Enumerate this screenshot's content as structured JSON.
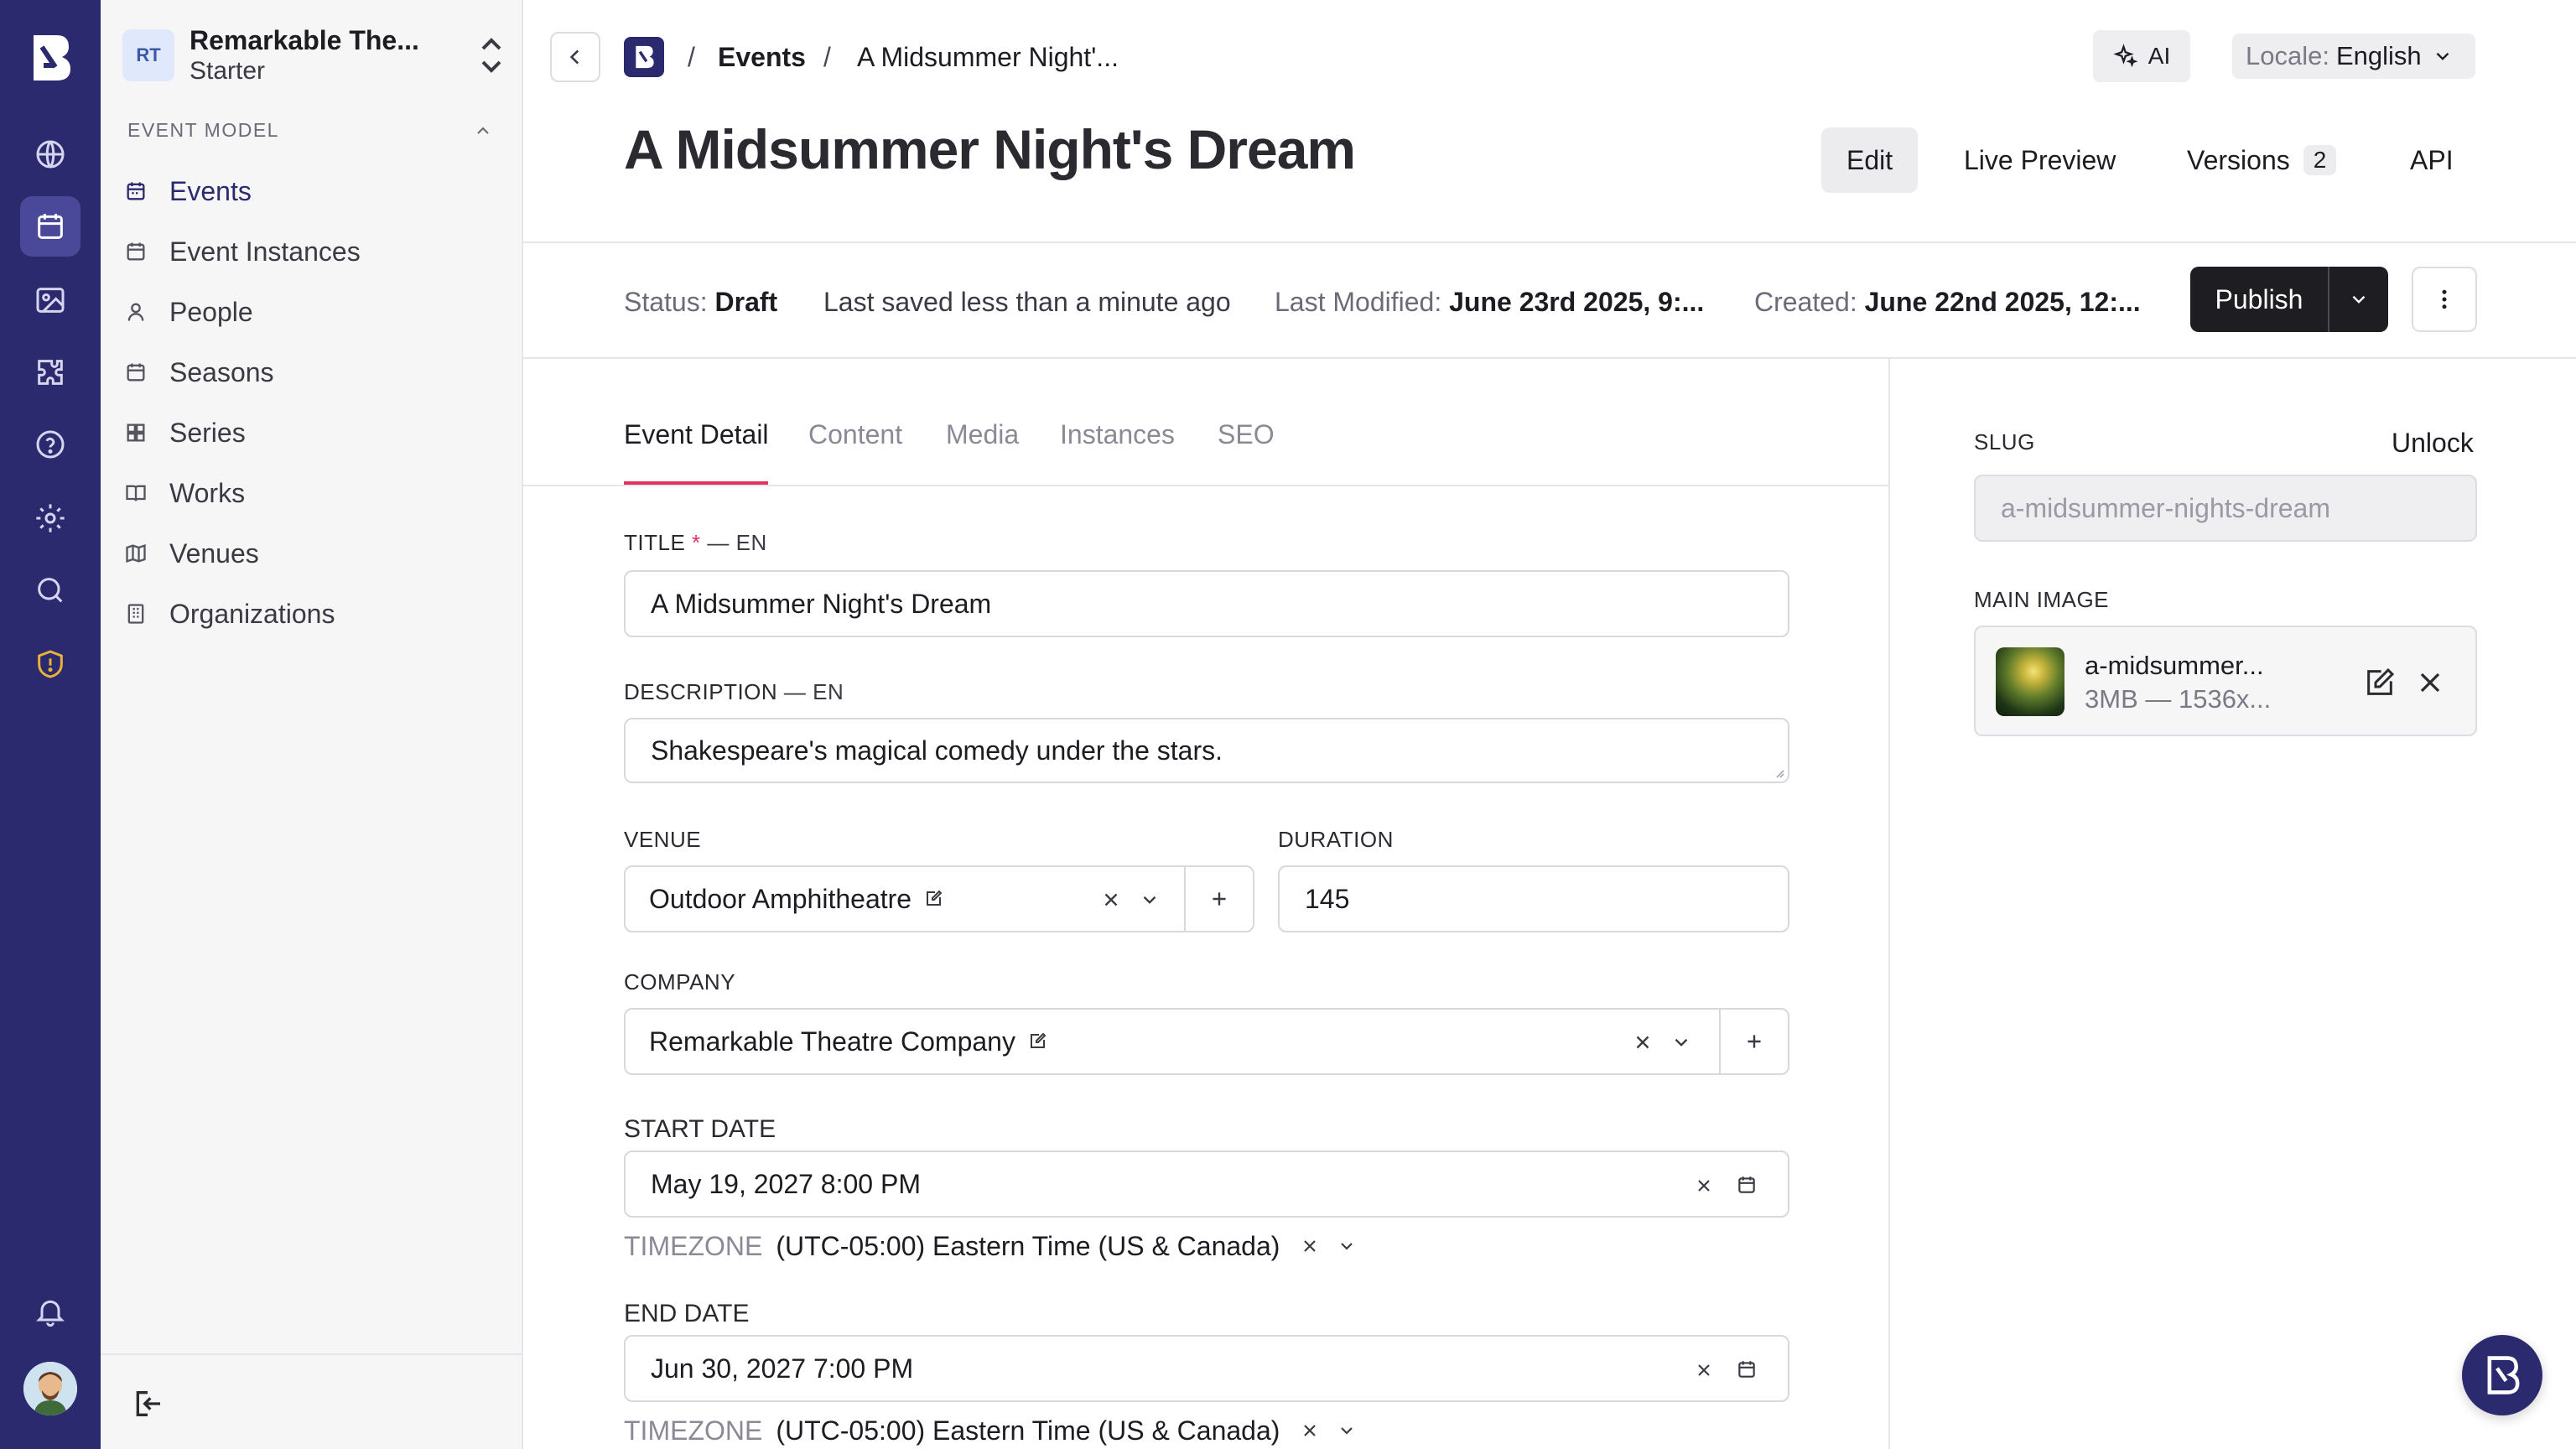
{
  "org": {
    "initials": "RT",
    "name": "Remarkable The...",
    "plan": "Starter"
  },
  "sidebar": {
    "section_label": "EVENT MODEL",
    "items": [
      {
        "label": "Events",
        "icon": "calendar-icon",
        "active": true
      },
      {
        "label": "Event Instances",
        "icon": "calendar-icon"
      },
      {
        "label": "People",
        "icon": "person-icon"
      },
      {
        "label": "Seasons",
        "icon": "calendar-icon"
      },
      {
        "label": "Series",
        "icon": "grid-icon"
      },
      {
        "label": "Works",
        "icon": "book-icon"
      },
      {
        "label": "Venues",
        "icon": "map-icon"
      },
      {
        "label": "Organizations",
        "icon": "building-icon"
      }
    ]
  },
  "rail": {
    "icons": [
      "globe-icon",
      "calendar-icon",
      "image-icon",
      "puzzle-icon",
      "help-icon",
      "settings-icon",
      "search-icon",
      "shield-alert-icon",
      "bell-icon"
    ],
    "active": "calendar-icon",
    "accent": "#2c2a6e"
  },
  "breadcrumb": {
    "sep": "/",
    "section": "Events",
    "page": "A Midsummer Night'..."
  },
  "header": {
    "ai_label": "AI",
    "locale_label": "Locale:",
    "locale_value": "English",
    "title": "A Midsummer Night's Dream",
    "tabs": [
      {
        "label": "Edit",
        "active": true
      },
      {
        "label": "Live Preview"
      },
      {
        "label": "Versions",
        "count": "2"
      },
      {
        "label": "API"
      }
    ]
  },
  "status": {
    "status_label": "Status:",
    "status_value": "Draft",
    "saved_text": "Last saved less than a minute ago",
    "modified_label": "Last Modified:",
    "modified_value": "June 23rd 2025, 9:...",
    "created_label": "Created:",
    "created_value": "June 22nd 2025, 12:...",
    "publish_label": "Publish"
  },
  "form": {
    "tabs": [
      {
        "label": "Event Detail",
        "active": true
      },
      {
        "label": "Content"
      },
      {
        "label": "Media"
      },
      {
        "label": "Instances"
      },
      {
        "label": "SEO"
      }
    ],
    "title": {
      "label": "TITLE",
      "required": "*",
      "locale": "— EN",
      "value": "A Midsummer Night's Dream"
    },
    "description": {
      "label": "DESCRIPTION",
      "locale": "— EN",
      "value": "Shakespeare's magical comedy under the stars."
    },
    "venue": {
      "label": "VENUE",
      "value": "Outdoor Amphitheatre"
    },
    "duration": {
      "label": "DURATION",
      "value": "145"
    },
    "company": {
      "label": "COMPANY",
      "value": "Remarkable Theatre Company"
    },
    "start_date": {
      "label": "START DATE",
      "value": "May 19, 2027 8:00 PM",
      "tz_label": "TIMEZONE",
      "tz_value": "(UTC-05:00) Eastern Time (US & Canada)"
    },
    "end_date": {
      "label": "END DATE",
      "value": "Jun 30, 2027 7:00 PM",
      "tz_label": "TIMEZONE",
      "tz_value": "(UTC-05:00) Eastern Time (US & Canada)"
    }
  },
  "aside": {
    "slug_label": "SLUG",
    "unlock_label": "Unlock",
    "slug_value": "a-midsummer-nights-dream",
    "main_image_label": "MAIN IMAGE",
    "image_name": "a-midsummer...",
    "image_meta": "3MB — 1536x..."
  },
  "colors": {
    "rail": "#2c2a6e",
    "tab_accent": "#e2335f",
    "publish": "#1e1e22"
  }
}
